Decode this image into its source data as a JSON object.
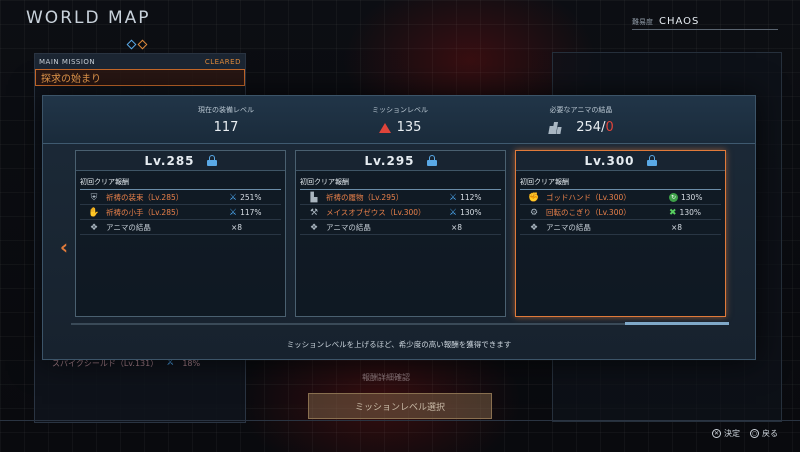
{
  "header": {
    "title": "WORLD MAP",
    "difficulty_label": "難易度",
    "difficulty_value": "CHAOS"
  },
  "main_mission": {
    "header": "MAIN MISSION",
    "status": "CLEARED",
    "title": "探求の始まり",
    "peek_item": "スパイクシールド（Lv.131）",
    "peek_value": "18%"
  },
  "stats": {
    "equip_label": "現在の装備レベル",
    "equip_value": "117",
    "mission_label": "ミッションレベル",
    "mission_value": "135",
    "anima_label": "必要なアニマの結晶",
    "anima_have": "254/",
    "anima_need": "0"
  },
  "cards": [
    {
      "level": "Lv.285",
      "section": "初回クリア報酬",
      "rewards": [
        {
          "icon": "armor-icon",
          "name": "祈祷の装束（Lv.285）",
          "bonus_icon": "sword-icon",
          "bonus": "251%"
        },
        {
          "icon": "gauntlet-icon",
          "name": "祈祷の小手（Lv.285）",
          "bonus_icon": "sword-icon",
          "bonus": "117%"
        },
        {
          "icon": "crystal-icon",
          "name": "アニマの結晶",
          "qty": "×8"
        }
      ]
    },
    {
      "level": "Lv.295",
      "section": "初回クリア報酬",
      "rewards": [
        {
          "icon": "boots-icon",
          "name": "祈祷の履物（Lv.295）",
          "bonus_icon": "sword-icon",
          "bonus": "112%"
        },
        {
          "icon": "mace-icon",
          "name": "メイスオブゼウス（Lv.300）",
          "bonus_icon": "sword-icon",
          "bonus": "130%"
        },
        {
          "icon": "crystal-icon",
          "name": "アニマの結晶",
          "qty": "×8"
        }
      ]
    },
    {
      "level": "Lv.300",
      "section": "初回クリア報酬",
      "rewards": [
        {
          "icon": "fist-icon",
          "name": "ゴッドハンド（Lv.300）",
          "bonus_icon": "green-circle-icon",
          "bonus": "130%"
        },
        {
          "icon": "saw-icon",
          "name": "回転のこぎり（Lv.300）",
          "bonus_icon": "green-cross-icon",
          "bonus": "130%"
        },
        {
          "icon": "crystal-icon",
          "name": "アニマの結晶",
          "qty": "×8"
        }
      ]
    }
  ],
  "footnote": "ミッションレベルを上げるほど、希少度の高い報酬を獲得できます",
  "detail_link": "報酬詳細確認",
  "select_button": "ミッションレベル選択",
  "controls": {
    "confirm": "決定",
    "back": "戻る"
  },
  "colors": {
    "accent_orange": "#e07a3a",
    "accent_blue": "#5aa9e6",
    "warn_red": "#e0443a"
  }
}
